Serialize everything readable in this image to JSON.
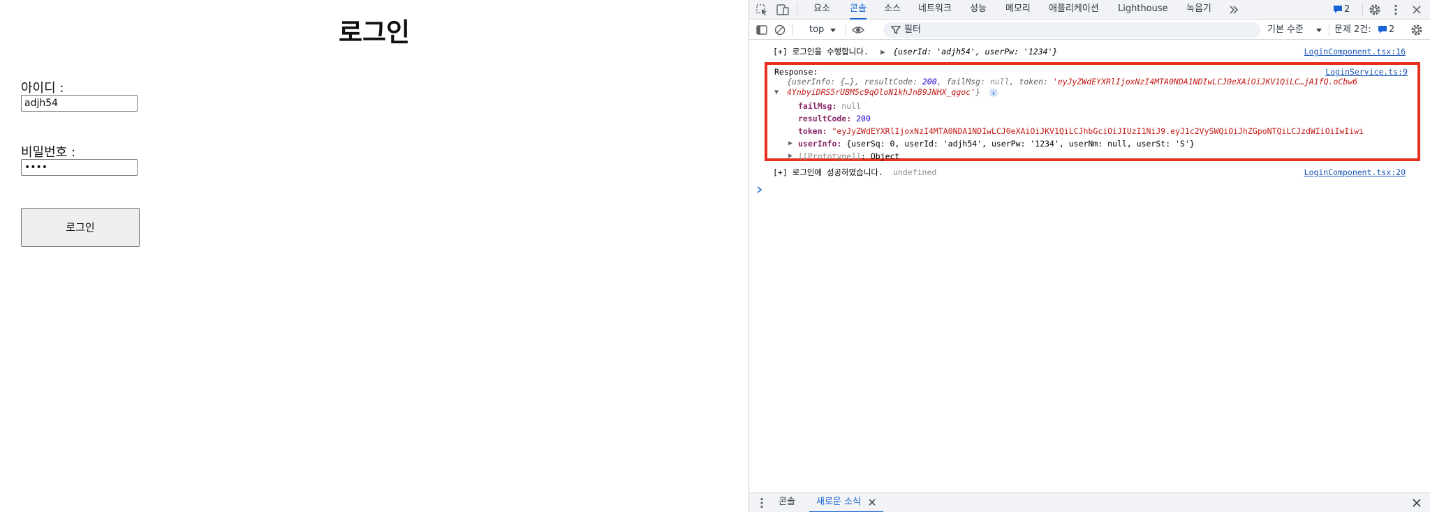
{
  "login": {
    "title": "로그인",
    "id_label": "아이디 :",
    "id_value": "adjh54",
    "pw_label": "비밀번호 :",
    "pw_value": "1234",
    "submit_label": "로그인"
  },
  "devtools": {
    "tabs": [
      "요소",
      "콘솔",
      "소스",
      "네트워크",
      "성능",
      "메모리",
      "애플리케이션",
      "Lighthouse",
      "녹음기"
    ],
    "active_tab": "콘솔",
    "issues_badge": "2",
    "context": "top",
    "filter_placeholder": "필터",
    "log_level": "기본 수준",
    "issues_label": "문제 2건:",
    "issues_count": "2",
    "logs": {
      "line1_prefix": "[+] 로그인을 수행합니다.",
      "line1_obj": "{userId: 'adjh54', userPw: '1234'}",
      "line1_src": "LoginComponent.tsx:16",
      "response_label": "Response:",
      "response_src": "LoginService.ts:9",
      "summary_a": "{userInfo: {…}, resultCode: ",
      "summary_code": "200",
      "summary_b": ", failMsg: ",
      "summary_null": "null",
      "summary_c": ", token: ",
      "summary_token1": "'eyJyZWdEYXRlIjoxNzI4MTA0NDA1NDIwLCJ0eXAiOiJKV1QiLC…jA1fQ.oCbw6",
      "summary_token2": "4YnbyiDRS5rUBM5c9qOloN1khJn89JNHX_qgoc'",
      "summary_close": "}",
      "failMsg_key": "failMsg:",
      "failMsg_val": "null",
      "resultCode_key": "resultCode:",
      "resultCode_val": "200",
      "token_key": "token:",
      "token_val": "\"eyJyZWdEYXRlIjoxNzI4MTA0NDA1NDIwLCJ0eXAiOiJKV1QiLCJhbGciOiJIUzI1NiJ9.eyJ1c2VySWQiOiJhZGpoNTQiLCJzdWIiOiIwIiwi",
      "userInfo_key": "userInfo:",
      "userInfo_val": "{userSq: 0, userId: 'adjh54', userPw: '1234', userNm: null, userSt: 'S'}",
      "proto_key": "[[Prototype]]",
      "proto_val": ": Object",
      "line3_prefix": "[+] 로그인에 성공하였습니다.",
      "line3_val": "undefined",
      "line3_src": "LoginComponent.tsx:20"
    },
    "drawer_tabs": [
      "콘솔",
      "새로운 소식"
    ],
    "drawer_active": "새로운 소식"
  },
  "colors": {
    "accent": "#1a63d4",
    "highlight_border": "#e8301e",
    "string": "#c41a16",
    "number": "#1c00cf"
  }
}
